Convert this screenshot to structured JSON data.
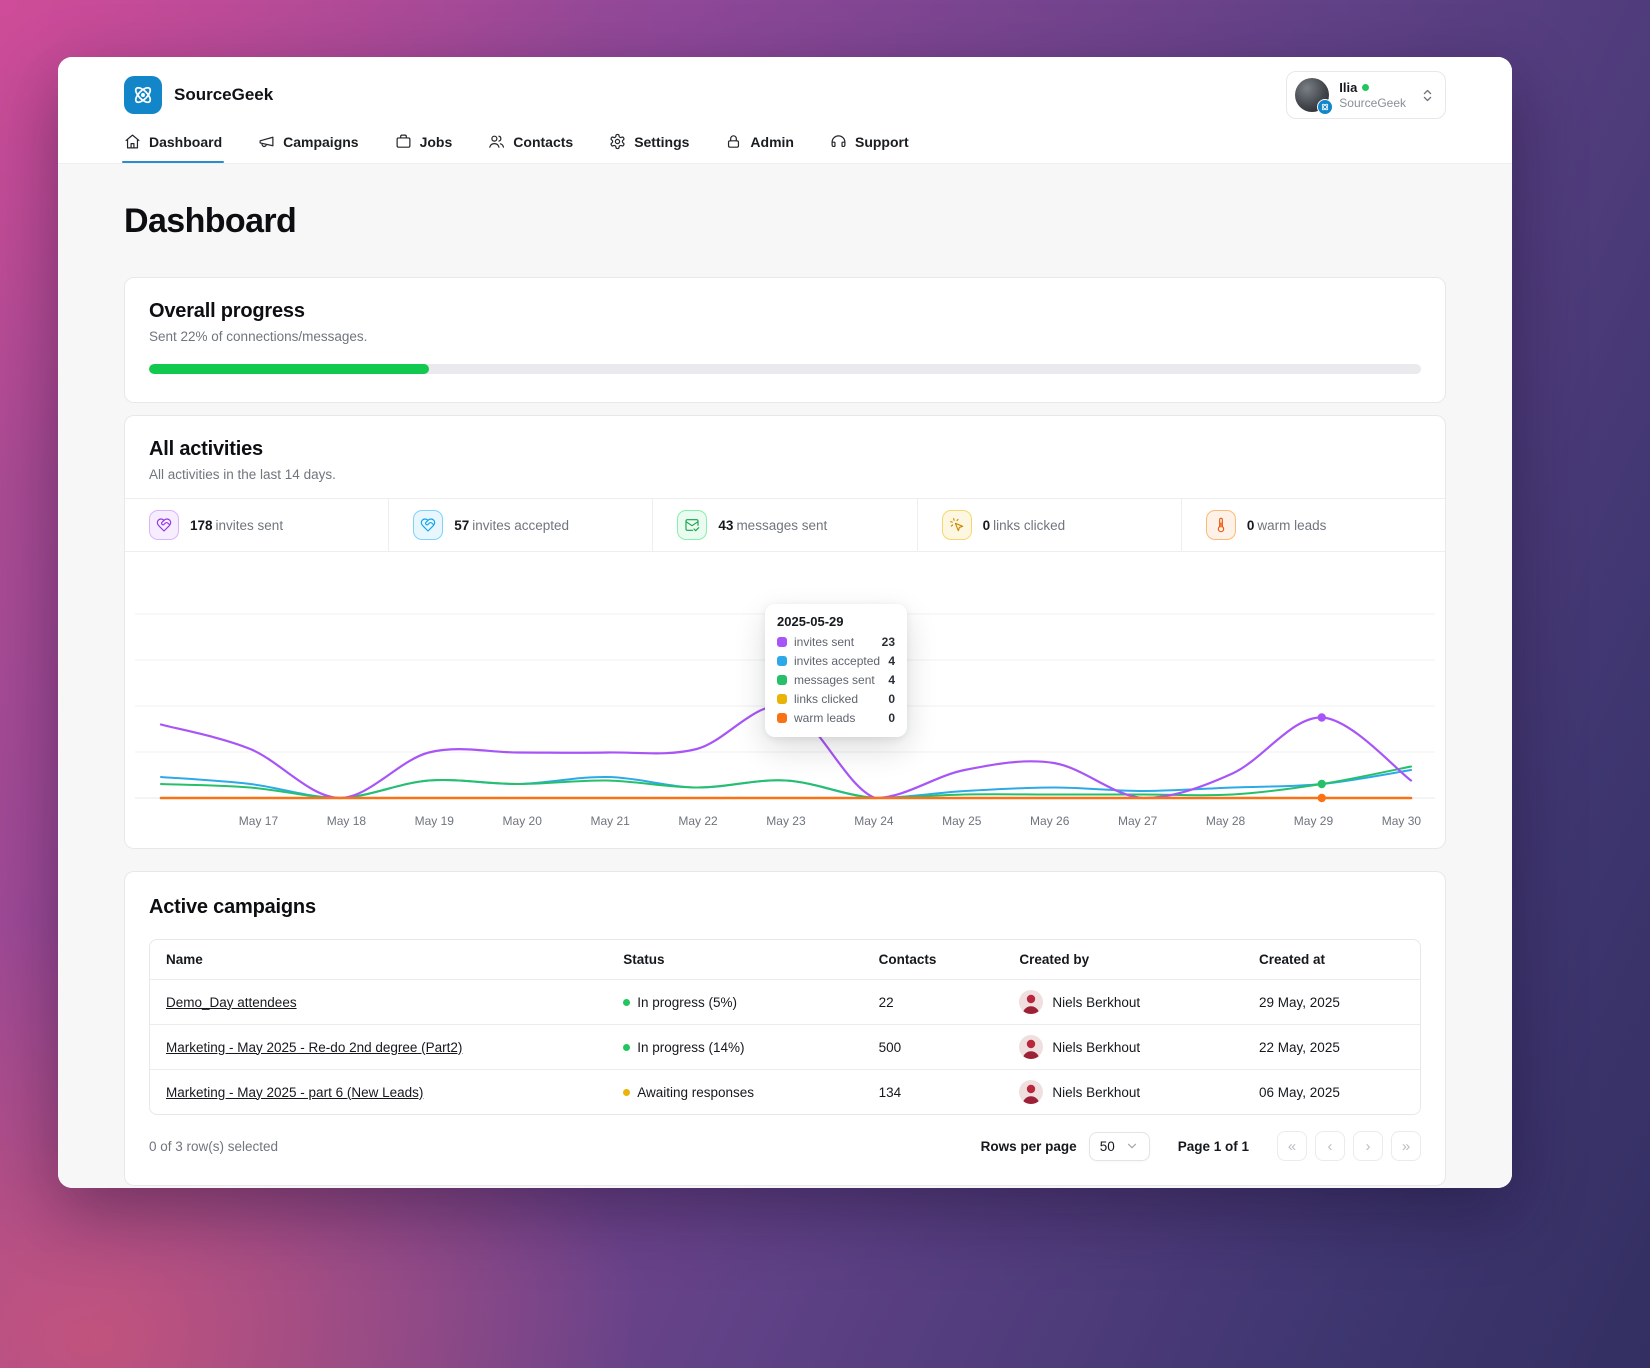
{
  "app": {
    "name": "SourceGeek"
  },
  "header": {
    "nav": [
      {
        "label": "Dashboard",
        "icon": "home",
        "active": true
      },
      {
        "label": "Campaigns",
        "icon": "megaphone",
        "active": false
      },
      {
        "label": "Jobs",
        "icon": "briefcase",
        "active": false
      },
      {
        "label": "Contacts",
        "icon": "users",
        "active": false
      },
      {
        "label": "Settings",
        "icon": "gear",
        "active": false
      },
      {
        "label": "Admin",
        "icon": "lock",
        "active": false
      },
      {
        "label": "Support",
        "icon": "headset",
        "active": false
      }
    ],
    "user": {
      "name": "Ilia",
      "org": "SourceGeek",
      "online_color": "#22c55e"
    }
  },
  "page": {
    "title": "Dashboard"
  },
  "overall_progress": {
    "title": "Overall progress",
    "subtitle": "Sent 22% of connections/messages.",
    "percent": 22,
    "bar_color": "#12c950"
  },
  "activities": {
    "title": "All activities",
    "subtitle": "All activities in the last 14 days.",
    "stats": [
      {
        "value": "178",
        "label": "invites sent",
        "icon": "heart-handshake",
        "color": "#9333ea",
        "bg": "#f6eefe",
        "border": "#d8b4fe"
      },
      {
        "value": "57",
        "label": "invites accepted",
        "icon": "heart-handshake",
        "color": "#0ea5e9",
        "bg": "#e8f6fe",
        "border": "#7dd3fc"
      },
      {
        "value": "43",
        "label": "messages sent",
        "icon": "mail-check",
        "color": "#16a34a",
        "bg": "#eafbf0",
        "border": "#86efac"
      },
      {
        "value": "0",
        "label": "links clicked",
        "icon": "pointer-click",
        "color": "#ca8a04",
        "bg": "#fdf7e1",
        "border": "#f3d96b"
      },
      {
        "value": "0",
        "label": "warm leads",
        "icon": "thermometer",
        "color": "#ea580c",
        "bg": "#fef1e7",
        "border": "#fdba74"
      }
    ]
  },
  "chart_data": {
    "type": "line",
    "x": [
      "",
      "May 17",
      "May 18",
      "May 19",
      "May 20",
      "May 21",
      "May 22",
      "May 23",
      "May 24",
      "May 25",
      "May 26",
      "May 27",
      "May 28",
      "May 29",
      "May 30"
    ],
    "series": [
      {
        "name": "invites sent",
        "color": "#a855f7",
        "values": [
          21,
          14,
          0,
          13,
          13,
          13,
          14,
          26,
          0,
          8,
          10,
          0,
          7,
          23,
          5
        ]
      },
      {
        "name": "invites accepted",
        "color": "#2da9e8",
        "values": [
          6,
          4,
          0,
          5,
          4,
          6,
          3,
          5,
          0,
          2,
          3,
          2,
          3,
          4,
          8
        ]
      },
      {
        "name": "messages sent",
        "color": "#27c06a",
        "values": [
          4,
          3,
          0,
          5,
          4,
          5,
          3,
          5,
          0,
          1,
          1,
          1,
          1,
          4,
          9
        ]
      },
      {
        "name": "links clicked",
        "color": "#eab308",
        "values": [
          0,
          0,
          0,
          0,
          0,
          0,
          0,
          0,
          0,
          0,
          0,
          0,
          0,
          0,
          0
        ]
      },
      {
        "name": "warm leads",
        "color": "#f97316",
        "values": [
          0,
          0,
          0,
          0,
          0,
          0,
          0,
          0,
          0,
          0,
          0,
          0,
          0,
          0,
          0
        ]
      }
    ],
    "ylim": [
      0,
      60
    ],
    "grid": true,
    "note": "first point is unlabeled left-edge lead-in; smooth spline curves",
    "tooltip": {
      "title": "2025-05-29",
      "index": 13,
      "values": [
        23,
        4,
        4,
        0,
        0
      ],
      "dot_series": [
        0,
        2,
        4
      ]
    }
  },
  "campaigns": {
    "title": "Active campaigns",
    "columns": [
      "Name",
      "Status",
      "Contacts",
      "Created by",
      "Created at"
    ],
    "rows": [
      {
        "name": "Demo_Day attendees",
        "status": "In progress (5%)",
        "status_color": "#22c55e",
        "contacts": "22",
        "created_by": "Niels Berkhout",
        "created_at": "29 May, 2025"
      },
      {
        "name": "Marketing - May 2025 - Re-do 2nd degree (Part2)",
        "status": "In progress (14%)",
        "status_color": "#22c55e",
        "contacts": "500",
        "created_by": "Niels Berkhout",
        "created_at": "22 May, 2025"
      },
      {
        "name": "Marketing - May 2025 - part 6 (New Leads)",
        "status": "Awaiting responses",
        "status_color": "#eab308",
        "contacts": "134",
        "created_by": "Niels Berkhout",
        "created_at": "06 May, 2025"
      }
    ],
    "footer": {
      "selected": "0 of 3 row(s) selected",
      "rows_per_page_label": "Rows per page",
      "rows_per_page_value": "50",
      "page_label": "Page 1 of 1",
      "pager": [
        "«",
        "‹",
        "›",
        "»"
      ]
    }
  }
}
